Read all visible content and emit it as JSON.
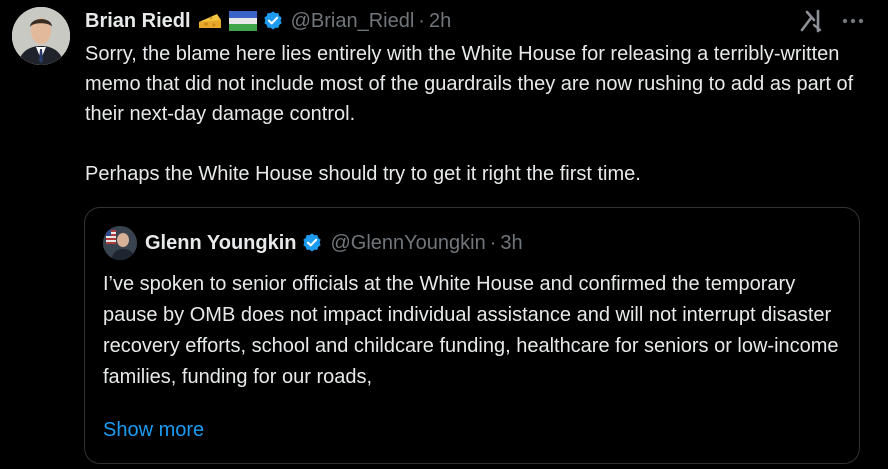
{
  "tweet": {
    "display_name": "Brian Riedl",
    "handle": "@Brian_Riedl",
    "separator": "·",
    "time": "2h",
    "paragraphs": [
      "Sorry, the blame here lies entirely with the White House for releasing a terribly-written memo that did not include most of the guardrails they are now rushing to add as part of their next-day damage control.",
      "Perhaps the White House should try to get it right the first time."
    ]
  },
  "quote": {
    "display_name": "Glenn Youngkin",
    "handle": "@GlennYoungkin",
    "separator": "·",
    "time": "3h",
    "text": "I’ve spoken to senior officials at the White House and confirmed the temporary pause by OMB does not impact individual assistance and will not interrupt disaster recovery efforts, school and childcare funding, healthcare for seniors or low-income families, funding for our roads,",
    "show_more": "Show more"
  },
  "icons": {
    "verified": "verified-badge-icon",
    "cheese": "cheese-emoji-icon",
    "flag": "flag-emoji-icon",
    "grok": "grok-icon",
    "more": "more-icon"
  },
  "colors": {
    "background": "#000000",
    "text": "#e7e9ea",
    "muted": "#71767b",
    "link": "#1d9bf0",
    "verified": "#1d9bf0",
    "border": "#2f3336"
  }
}
